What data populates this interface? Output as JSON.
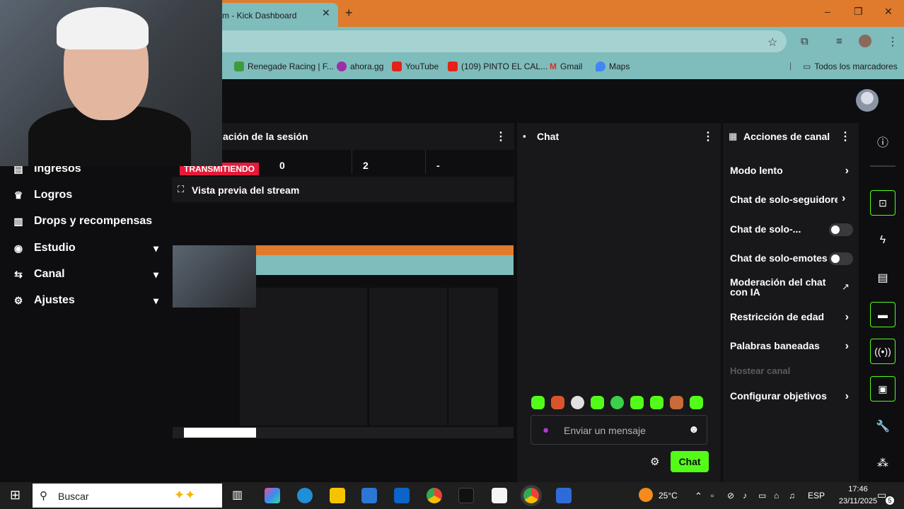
{
  "browser": {
    "tab_title": "m - Kick Dashboard",
    "new_tab_symbol": "+",
    "window_controls": [
      "–",
      "❐",
      "✕"
    ],
    "bookmarks": [
      {
        "label": "Renegade Racing | F...",
        "color": "#3c9c3c"
      },
      {
        "label": "ahora.gg",
        "color": "#9b2fa8"
      },
      {
        "label": "YouTube",
        "color": "#e62117"
      },
      {
        "label": "(109) PINTO EL CAL...",
        "color": "#e62117"
      },
      {
        "label": "Gmail",
        "color": "#d93025"
      },
      {
        "label": "Maps",
        "color": "#4285f4"
      }
    ],
    "all_bookmarks": "Todos los marcadores"
  },
  "sidebar": {
    "items": [
      {
        "label": "Ingresos",
        "icon": "money-icon",
        "glyph": "▤"
      },
      {
        "label": "Logros",
        "icon": "trophy-icon",
        "glyph": "🏆"
      },
      {
        "label": "Drops y recompensas",
        "icon": "gift-icon",
        "glyph": "▥"
      },
      {
        "label": "Estudio",
        "icon": "studio-icon",
        "glyph": "◉",
        "chevron": "⌄"
      },
      {
        "label": "Canal",
        "icon": "channel-icon",
        "glyph": "⇆",
        "chevron": "⌄"
      },
      {
        "label": "Ajustes",
        "icon": "gear-icon",
        "glyph": "⚙",
        "chevron": "⌄"
      }
    ]
  },
  "session": {
    "title": "ación de la sesión",
    "status_badge": "TRANSMITIENDO",
    "stats": [
      "0",
      "2",
      "-"
    ]
  },
  "preview": {
    "title": "Vista previa del stream"
  },
  "chat": {
    "title": "Chat",
    "input_placeholder": "Enviar un mensaje",
    "send_label": "Chat",
    "emote_color": "#53fc18"
  },
  "actions": {
    "title": "Acciones de canal",
    "items": [
      {
        "label": "Modo lento",
        "control": "chevron"
      },
      {
        "label": "Chat de solo-seguidores",
        "control": "chevron"
      },
      {
        "label": "Chat de solo-...",
        "control": "toggle"
      },
      {
        "label": "Chat de solo-emotes",
        "control": "toggle"
      },
      {
        "label": "Moderación del chat con IA",
        "control": "external"
      },
      {
        "label": "Restricción de edad",
        "control": "chevron"
      },
      {
        "label": "Palabras baneadas",
        "control": "chevron"
      },
      {
        "label": "Hostear canal",
        "control": "none",
        "disabled": true
      },
      {
        "label": "Configurar objetivos",
        "control": "chevron"
      }
    ]
  },
  "taskbar": {
    "search_placeholder": "Buscar",
    "weather": "25°C",
    "language": "ESP",
    "time": "17:46",
    "date": "23/11/2025",
    "notification_count": "5"
  },
  "colors": {
    "kick_green": "#53fc18",
    "live_red": "#e5193a",
    "panel_bg": "#18181b",
    "page_bg": "#0e0e10"
  }
}
